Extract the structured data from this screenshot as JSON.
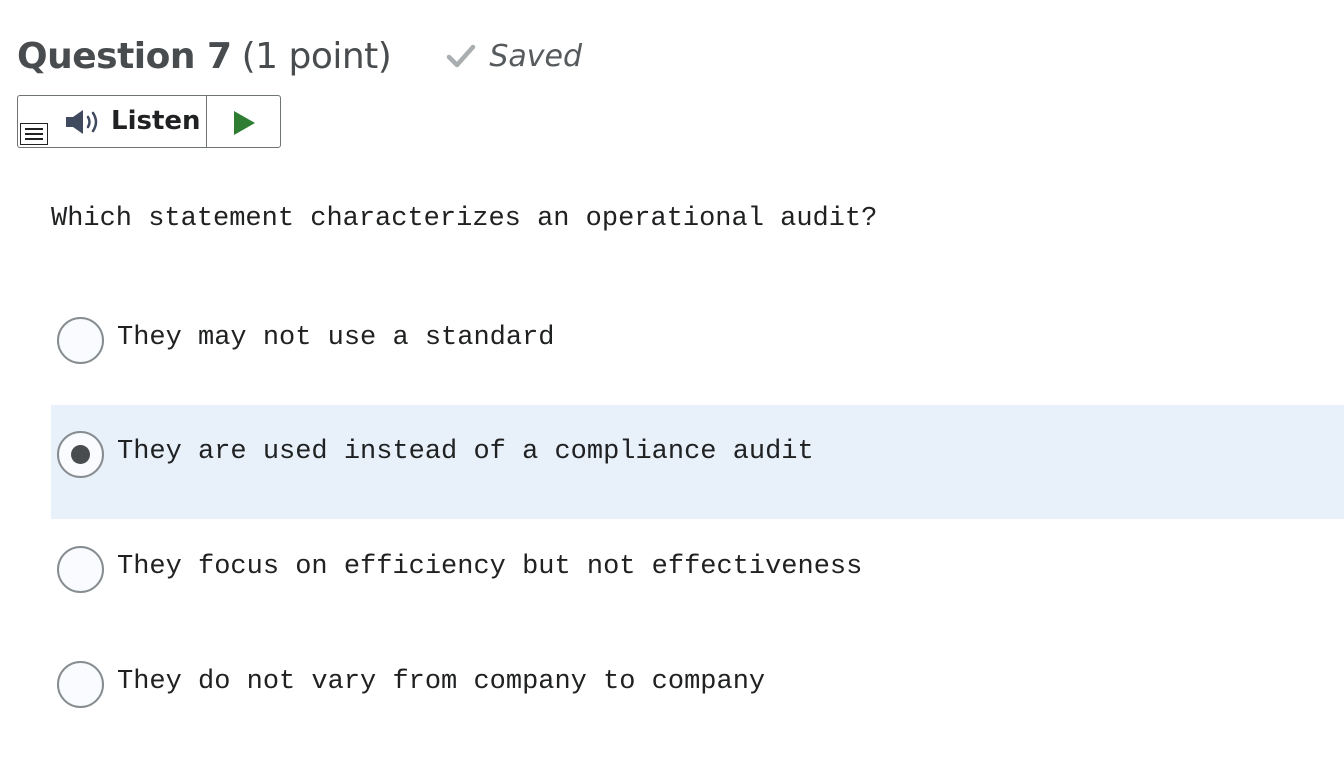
{
  "question": {
    "title": "Question 7",
    "points": "(1 point)",
    "status": "Saved",
    "text": "Which statement characterizes an operational audit?"
  },
  "toolbar": {
    "listen_label": "Listen"
  },
  "options": [
    {
      "label": "They may not use a standard",
      "selected": false
    },
    {
      "label": "They are used instead of a compliance audit",
      "selected": true
    },
    {
      "label": "They focus on efficiency but not effectiveness",
      "selected": false
    },
    {
      "label": "They do not vary from company to company",
      "selected": false
    }
  ],
  "colors": {
    "selected_row_bg": "#e8f1fa",
    "play_icon": "#2e7d32",
    "check_icon": "#a9aeb1",
    "text": "#202122"
  },
  "icons": {
    "status": "checkmark-icon",
    "listen": "speaker-icon",
    "menu": "menu-icon",
    "play": "play-icon"
  }
}
